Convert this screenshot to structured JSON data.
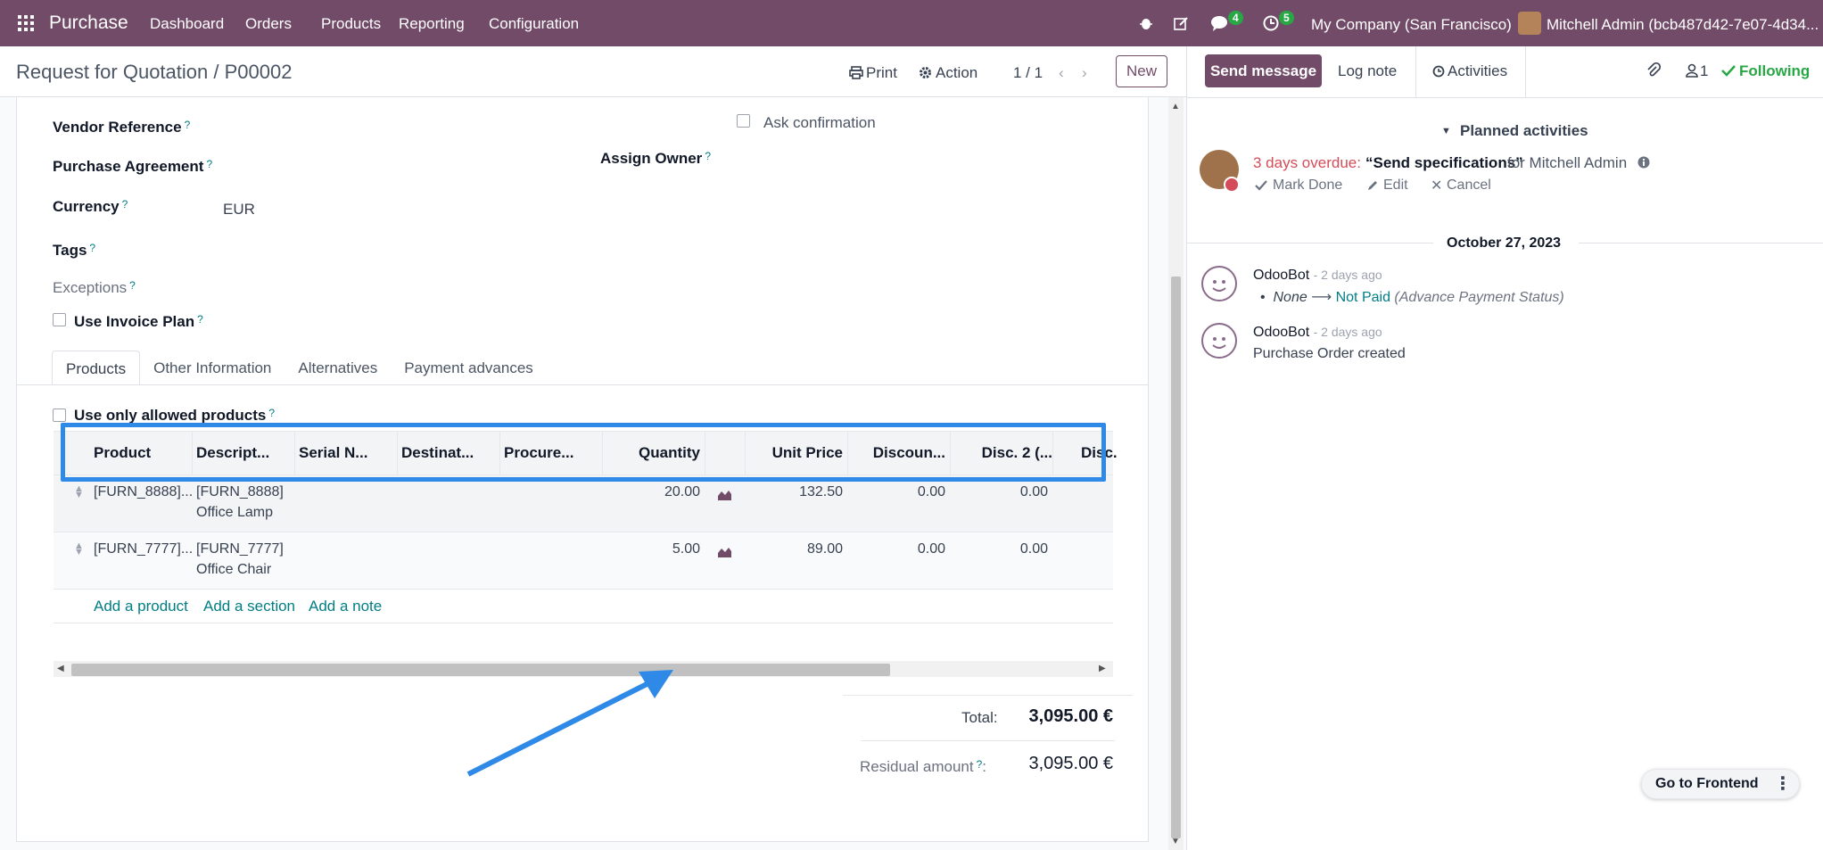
{
  "navbar": {
    "app_name": "Purchase",
    "menu": [
      "Dashboard",
      "Orders",
      "Products",
      "Reporting",
      "Configuration"
    ],
    "chat_count": "4",
    "activity_count": "5",
    "company": "My Company (San Francisco)",
    "user": "Mitchell Admin (bcb487d42-7e07-4d34..."
  },
  "control_panel": {
    "breadcrumb": "Request for Quotation / P00002",
    "print": "Print",
    "action": "Action",
    "pager": "1 / 1",
    "new": "New"
  },
  "form": {
    "vendor_reference": "Vendor Reference",
    "purchase_agreement": "Purchase Agreement",
    "currency_label": "Currency",
    "currency_value": "EUR",
    "tags": "Tags",
    "exceptions": "Exceptions",
    "use_invoice_plan": "Use Invoice Plan",
    "ask_confirmation": "Ask confirmation",
    "assign_owner": "Assign Owner",
    "q": "?"
  },
  "tabs": [
    "Products",
    "Other Information",
    "Alternatives",
    "Payment advances"
  ],
  "use_only_allowed": "Use only allowed products",
  "table": {
    "headers": [
      "Product",
      "Descript...",
      "Serial N...",
      "Destinat...",
      "Procure...",
      "Quantity",
      "Unit Price",
      "Discoun...",
      "Disc. 2 (...",
      "Disc."
    ],
    "rows": [
      {
        "product": "[FURN_8888]...",
        "desc1": "[FURN_8888]",
        "desc2": "Office Lamp",
        "qty": "20.00",
        "price": "132.50",
        "disc": "0.00",
        "disc2": "0.00"
      },
      {
        "product": "[FURN_7777]...",
        "desc1": "[FURN_7777]",
        "desc2": "Office Chair",
        "qty": "5.00",
        "price": "89.00",
        "disc": "0.00",
        "disc2": "0.00"
      }
    ],
    "add_product": "Add a product",
    "add_section": "Add a section",
    "add_note": "Add a note"
  },
  "totals": {
    "total_label": "Total:",
    "total_value": "3,095.00 €",
    "residual_label": "Residual amount",
    "residual_suffix": ":",
    "residual_value": "3,095.00 €"
  },
  "chatter": {
    "send_message": "Send message",
    "log_note": "Log note",
    "activities": "Activities",
    "followers": "1",
    "following": "Following",
    "planned": "Planned activities",
    "overdue": "3 days overdue:",
    "activity_title": "“Send specifications”",
    "activity_for": "for Mitchell Admin",
    "mark_done": "Mark Done",
    "edit": "Edit",
    "cancel": "Cancel",
    "date_sep": "October 27, 2023",
    "messages": [
      {
        "author": "OdooBot",
        "time": "- 2 days ago",
        "old": "None",
        "new": "Not Paid",
        "field": "(Advance Payment Status)"
      },
      {
        "author": "OdooBot",
        "time": "- 2 days ago",
        "body": "Purchase Order created"
      }
    ]
  },
  "go_frontend": "Go to Frontend",
  "colors": {
    "brand": "#714b67",
    "link": "#017e84",
    "highlight": "#2e8ae6",
    "overdue": "#d44c59"
  }
}
